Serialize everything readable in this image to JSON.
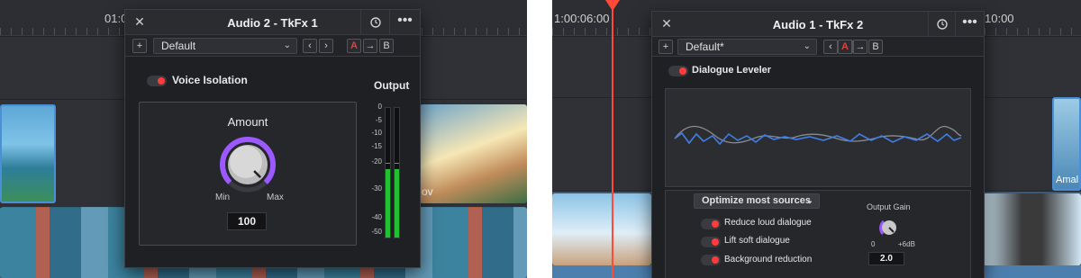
{
  "left": {
    "timeline": {
      "timecode": "01:0",
      "clip_label": "ov"
    },
    "dialog": {
      "title": "Audio 2 - TkFx 1",
      "preset": "Default",
      "ab": {
        "a": "A",
        "arrow": "→",
        "b": "B"
      },
      "effect_name": "Voice Isolation",
      "enabled": true,
      "knob": {
        "label": "Amount",
        "min_label": "Min",
        "max_label": "Max",
        "value": "100",
        "level": 1.0
      },
      "meter": {
        "title": "Output",
        "scale": [
          "0",
          "-5",
          "-10",
          "-15",
          "-20",
          "-30",
          "-40",
          "-50"
        ],
        "peak_marker_db": -20,
        "left_level_db": -23,
        "right_level_db": -23
      }
    }
  },
  "right": {
    "timeline": {
      "timecode": "1:00:06:00",
      "timecode_right": "10:00",
      "clip_label": "Amal"
    },
    "dialog": {
      "title": "Audio 1 - TkFx 2",
      "preset": "Default*",
      "ab": {
        "a": "A",
        "arrow": "→",
        "b": "B"
      },
      "effect_name": "Dialogue Leveler",
      "enabled": true,
      "mode_select": "Optimize most sources",
      "options": [
        {
          "label": "Reduce loud dialogue",
          "on": true
        },
        {
          "label": "Lift soft dialogue",
          "on": true
        },
        {
          "label": "Background reduction",
          "on": true
        }
      ],
      "output_gain": {
        "label": "Output Gain",
        "min_label": "0",
        "max_label": "+6dB",
        "value": "2.0"
      }
    }
  },
  "colors": {
    "accent_red": "#ff3b3b",
    "knob_ring": "#9b59ff",
    "meter_green": "#22c033",
    "wave_blue": "#3f7ee8",
    "wave_gray": "#8a8b8f"
  },
  "icons": {
    "close": "close-icon",
    "reset": "reset-icon",
    "more": "more-icon",
    "add": "plus-icon"
  }
}
